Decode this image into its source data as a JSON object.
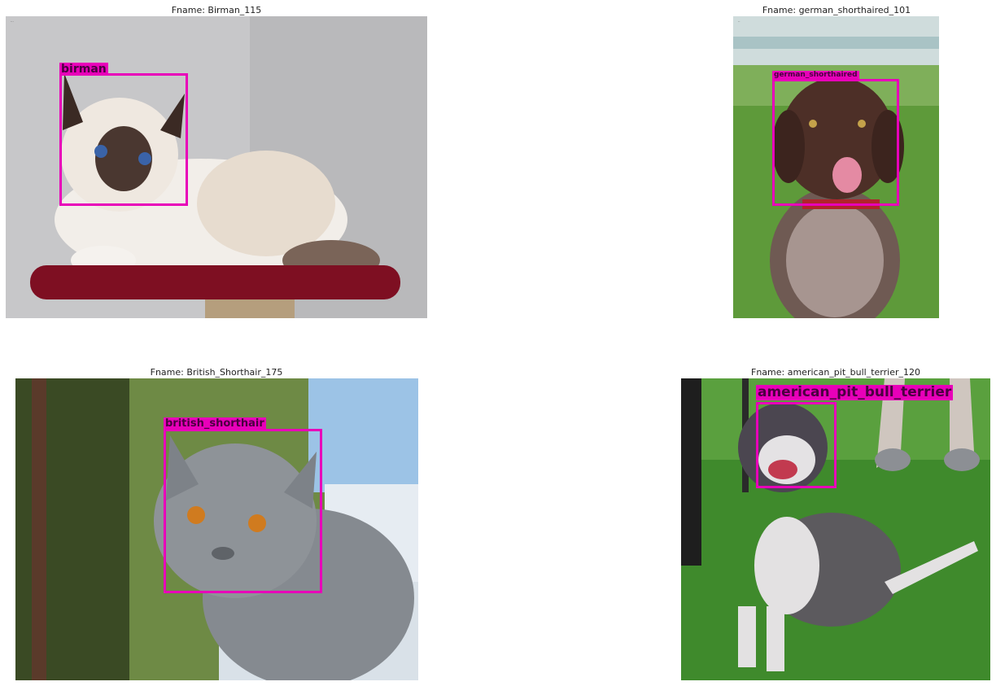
{
  "panels": [
    {
      "title": "Fname: Birman_115",
      "label": "birman"
    },
    {
      "title": "Fname: german_shorthaired_101",
      "label": "german_shorthaired"
    },
    {
      "title": "Fname: British_Shorthair_175",
      "label": "british_shorthair"
    },
    {
      "title": "Fname: american_pit_bull_terrier_120",
      "label": "american_pit_bull_terrier"
    }
  ],
  "colors": {
    "box": "#e800b9",
    "label_text": "#4a0040"
  }
}
